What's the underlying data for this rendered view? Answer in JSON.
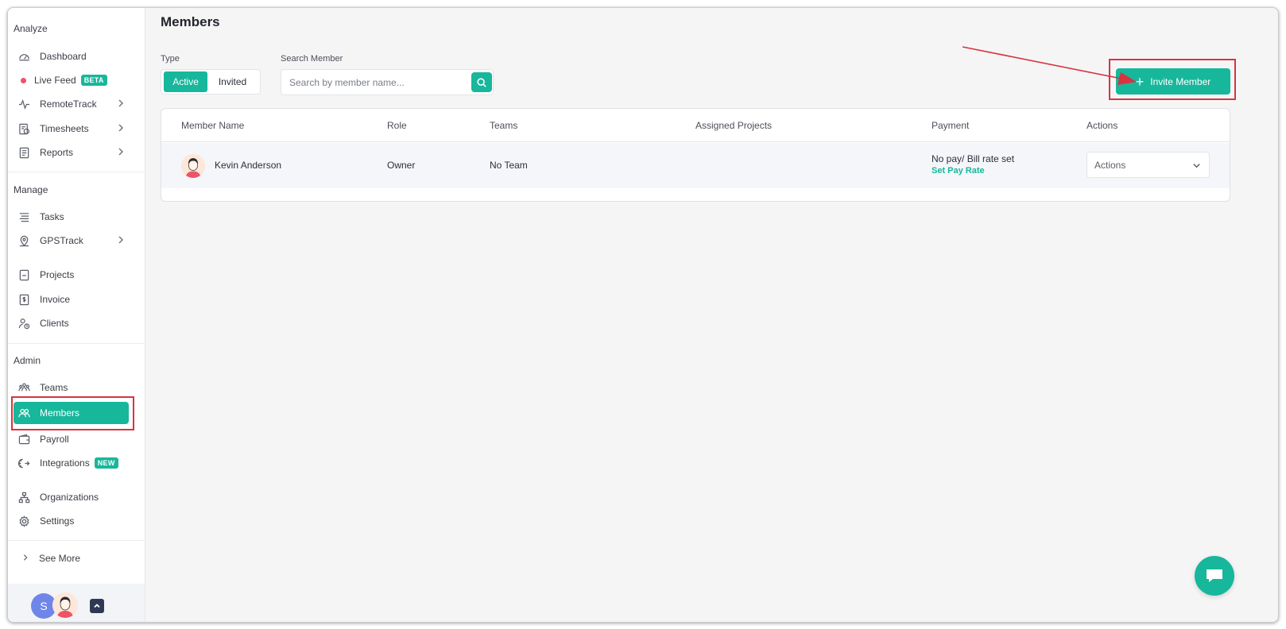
{
  "colors": {
    "accent": "#17b79b",
    "highlight": "#d9333f",
    "live_dot": "#ef5366"
  },
  "sidebar": {
    "analyze_title": "Analyze",
    "manage_title": "Manage",
    "admin_title": "Admin",
    "items": [
      {
        "label": "Dashboard",
        "icon": "gauge-icon"
      },
      {
        "label": "Live Feed",
        "badge": "BETA"
      },
      {
        "label": "RemoteTrack",
        "icon": "activity-icon"
      },
      {
        "label": "Timesheets",
        "icon": "timesheet-icon"
      },
      {
        "label": "Reports",
        "icon": "report-icon"
      },
      {
        "label": "Tasks",
        "icon": "tasks-icon"
      },
      {
        "label": "GPSTrack",
        "icon": "location-icon"
      },
      {
        "label": "Projects",
        "icon": "project-icon"
      },
      {
        "label": "Invoice",
        "icon": "invoice-icon"
      },
      {
        "label": "Clients",
        "icon": "clients-icon"
      },
      {
        "label": "Teams",
        "icon": "teams-icon"
      },
      {
        "label": "Members",
        "icon": "members-icon",
        "active": true
      },
      {
        "label": "Payroll",
        "icon": "wallet-icon"
      },
      {
        "label": "Integrations",
        "badge": "NEW",
        "icon": "integrations-icon"
      },
      {
        "label": "Organizations",
        "icon": "org-icon"
      },
      {
        "label": "Settings",
        "icon": "gear-icon"
      }
    ],
    "see_more": "See More",
    "avatar_initial": "S"
  },
  "main": {
    "title": "Members",
    "type_label": "Type",
    "type_active": "Active",
    "type_invited": "Invited",
    "search_label": "Search Member",
    "search_placeholder": "Search by member name...",
    "invite_button": "Invite Member",
    "table": {
      "headers": [
        "Member Name",
        "Role",
        "Teams",
        "Assigned Projects",
        "Payment",
        "Actions"
      ],
      "rows": [
        {
          "name": "Kevin Anderson",
          "role": "Owner",
          "teams": "No Team",
          "projects": "",
          "payment": "No pay/ Bill rate set",
          "payment_link": "Set Pay Rate",
          "actions": "Actions"
        }
      ]
    }
  }
}
